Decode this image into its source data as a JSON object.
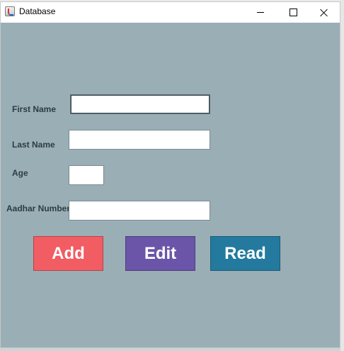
{
  "window": {
    "title": "Database",
    "icon": "java-cup-icon",
    "background_color": "#9aaeb5"
  },
  "form": {
    "first_name": {
      "label": "First Name",
      "value": ""
    },
    "last_name": {
      "label": "Last Name",
      "value": ""
    },
    "age": {
      "label": "Age",
      "value": ""
    },
    "aadhar_number": {
      "label": "Aadhar Number",
      "value": ""
    }
  },
  "buttons": {
    "add": {
      "label": "Add",
      "color": "#f25c63"
    },
    "edit": {
      "label": "Edit",
      "color": "#6a55a8"
    },
    "read": {
      "label": "Read",
      "color": "#237a9e"
    }
  }
}
